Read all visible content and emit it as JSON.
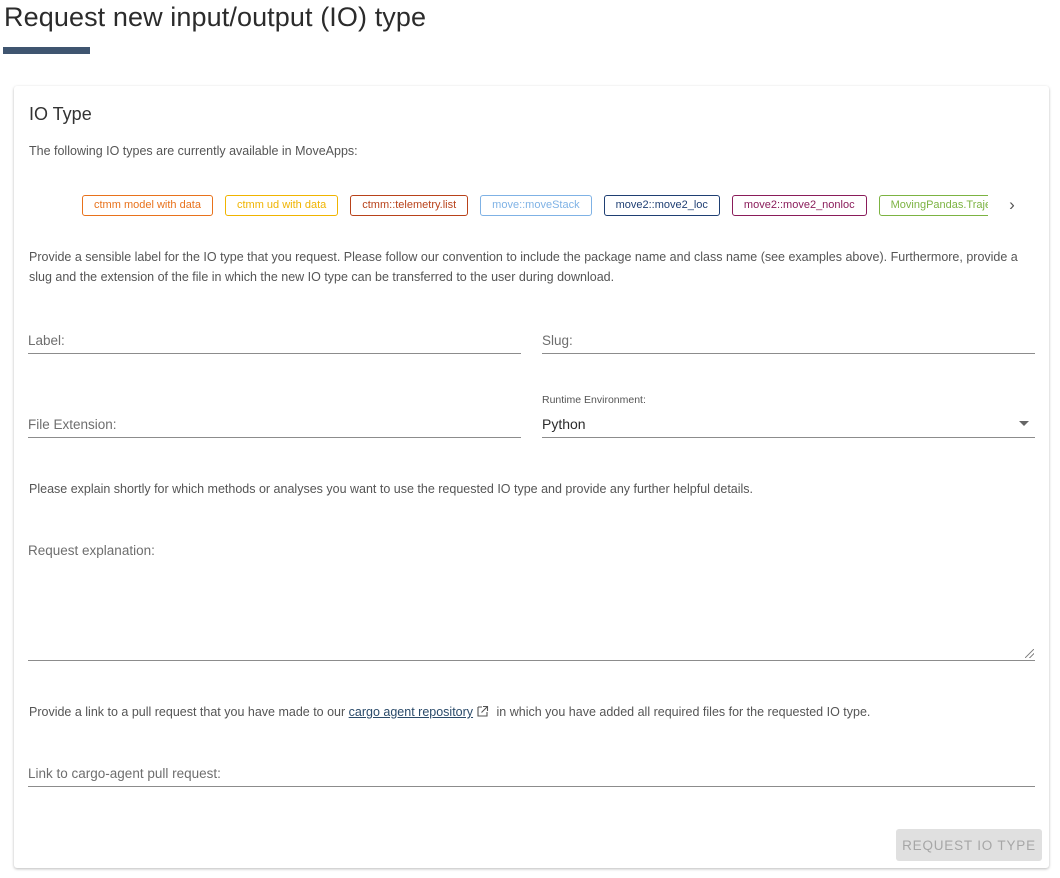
{
  "page": {
    "title": "Request new input/output (IO) type"
  },
  "card": {
    "title": "IO Type",
    "intro": "The following IO types are currently available in MoveApps:",
    "io_types": [
      {
        "label": "ctmm model with data",
        "color": "#e8721c"
      },
      {
        "label": "ctmm ud with data",
        "color": "#f0b400"
      },
      {
        "label": "ctmm::telemetry.list",
        "color": "#b8421a"
      },
      {
        "label": "move::moveStack",
        "color": "#7fb2e5"
      },
      {
        "label": "move2::move2_loc",
        "color": "#1f3f73"
      },
      {
        "label": "move2::move2_nonloc",
        "color": "#8a1c5a"
      },
      {
        "label": "MovingPandas.TrajectoryCollection",
        "color": "#7cb342"
      }
    ],
    "description": "Provide a sensible label for the IO type that you request. Please follow our convention to include the package name and class name (see examples above). Furthermore, provide a slug and the extension of the file in which the new IO type can be transferred to the user during download.",
    "fields": {
      "label_placeholder": "Label:",
      "slug_placeholder": "Slug:",
      "file_extension_placeholder": "File Extension:",
      "runtime_label": "Runtime Environment:",
      "runtime_value": "Python"
    },
    "explain_text": "Please explain shortly for which methods or analyses you want to use the requested IO type and provide any further helpful details.",
    "request_explanation_placeholder": "Request explanation:",
    "pr_text_before": "Provide a link to a pull request that you have made to our",
    "pr_link_text": "cargo agent repository",
    "pr_text_after": "in which you have added all required files for the requested IO type.",
    "pr_link_placeholder": "Link to cargo-agent pull request:",
    "submit_label": "REQUEST IO TYPE"
  }
}
